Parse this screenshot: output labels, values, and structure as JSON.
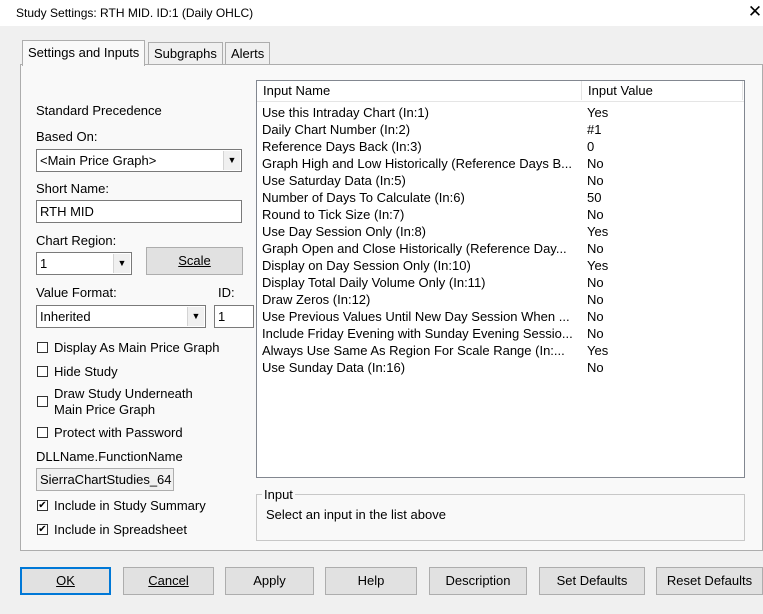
{
  "window": {
    "title": "Study Settings: RTH MID. ID:1 (Daily OHLC)",
    "close_glyph": "✕"
  },
  "tabs": [
    {
      "label": "Settings and Inputs",
      "active": true
    },
    {
      "label": "Subgraphs",
      "active": false
    },
    {
      "label": "Alerts",
      "active": false
    }
  ],
  "left": {
    "standard_precedence": "Standard Precedence",
    "based_on_label": "Based On:",
    "based_on_value": "<Main Price Graph>",
    "short_name_label": "Short Name:",
    "short_name_value": "RTH MID",
    "chart_region_label": "Chart Region:",
    "chart_region_value": "1",
    "scale_button": "Scale",
    "value_format_label": "Value Format:",
    "value_format_value": "Inherited",
    "id_label": "ID:",
    "id_value": "1",
    "checkboxes": [
      {
        "label": "Display As Main Price Graph",
        "checked": false
      },
      {
        "label": "Hide Study",
        "checked": false
      },
      {
        "label": "Draw Study Underneath",
        "label2": "Main Price Graph",
        "checked": false
      },
      {
        "label": "Protect with Password",
        "checked": false
      }
    ],
    "dll_label": "DLLName.FunctionName",
    "dll_value": "SierraChartStudies_64",
    "summary_checks": [
      {
        "label": "Include in Study Summary",
        "checked": true
      },
      {
        "label": "Include in Spreadsheet",
        "checked": true
      }
    ]
  },
  "inputs_table": {
    "columns": [
      "Input Name",
      "Input Value"
    ],
    "rows": [
      {
        "name": "Use this Intraday Chart  (In:1)",
        "value": "Yes"
      },
      {
        "name": "Daily Chart Number  (In:2)",
        "value": "#1"
      },
      {
        "name": "Reference Days Back  (In:3)",
        "value": "0"
      },
      {
        "name": "Graph High and Low Historically (Reference Days B...",
        "value": "No"
      },
      {
        "name": "Use Saturday Data  (In:5)",
        "value": "No"
      },
      {
        "name": "Number of Days To Calculate  (In:6)",
        "value": "50"
      },
      {
        "name": "Round to Tick Size  (In:7)",
        "value": "No"
      },
      {
        "name": "Use Day Session Only  (In:8)",
        "value": "Yes"
      },
      {
        "name": "Graph Open and Close Historically (Reference Day...",
        "value": "No"
      },
      {
        "name": "Display on Day Session Only  (In:10)",
        "value": "Yes"
      },
      {
        "name": "Display Total Daily Volume Only  (In:11)",
        "value": "No"
      },
      {
        "name": "Draw Zeros  (In:12)",
        "value": "No"
      },
      {
        "name": "Use Previous Values Until New Day Session When ...",
        "value": "No"
      },
      {
        "name": "Include Friday Evening with Sunday Evening Sessio...",
        "value": "No"
      },
      {
        "name": "Always Use Same As Region For Scale Range  (In:...",
        "value": "Yes"
      },
      {
        "name": "Use Sunday Data  (In:16)",
        "value": "No"
      }
    ]
  },
  "input_group": {
    "title": "Input",
    "text": "Select an input in the list above"
  },
  "buttons": {
    "ok": "OK",
    "cancel": "Cancel",
    "apply": "Apply",
    "help": "Help",
    "description": "Description",
    "set_defaults": "Set Defaults",
    "reset_defaults": "Reset Defaults"
  },
  "icons": {
    "dropdown": "chevron-down-icon",
    "check": "check-icon"
  }
}
